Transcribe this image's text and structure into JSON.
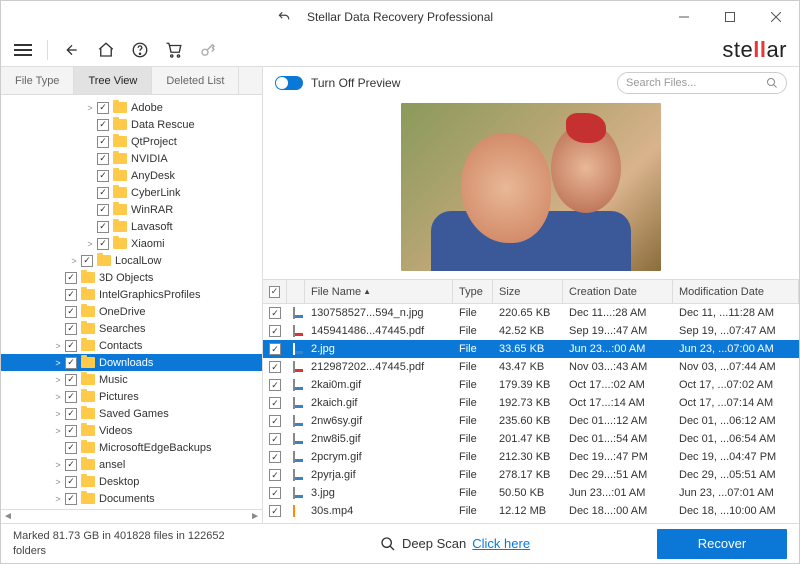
{
  "title": "Stellar Data Recovery Professional",
  "logo": "stellar",
  "tabs": {
    "fileType": "File Type",
    "treeView": "Tree View",
    "deletedList": "Deleted List"
  },
  "previewToggleLabel": "Turn Off Preview",
  "searchPlaceholder": "Search Files...",
  "tree": [
    {
      "indent": 3,
      "arrow": ">",
      "label": "Adobe"
    },
    {
      "indent": 3,
      "arrow": "",
      "label": "Data Rescue"
    },
    {
      "indent": 3,
      "arrow": "",
      "label": "QtProject"
    },
    {
      "indent": 3,
      "arrow": "",
      "label": "NVIDIA"
    },
    {
      "indent": 3,
      "arrow": "",
      "label": "AnyDesk"
    },
    {
      "indent": 3,
      "arrow": "",
      "label": "CyberLink"
    },
    {
      "indent": 3,
      "arrow": "",
      "label": "WinRAR"
    },
    {
      "indent": 3,
      "arrow": "",
      "label": "Lavasoft"
    },
    {
      "indent": 3,
      "arrow": ">",
      "label": "Xiaomi"
    },
    {
      "indent": 2,
      "arrow": ">",
      "label": "LocalLow"
    },
    {
      "indent": 1,
      "arrow": "",
      "label": "3D Objects"
    },
    {
      "indent": 1,
      "arrow": "",
      "label": "IntelGraphicsProfiles"
    },
    {
      "indent": 1,
      "arrow": "",
      "label": "OneDrive"
    },
    {
      "indent": 1,
      "arrow": "",
      "label": "Searches"
    },
    {
      "indent": 1,
      "arrow": ">",
      "label": "Contacts"
    },
    {
      "indent": 1,
      "arrow": ">",
      "label": "Downloads",
      "selected": true
    },
    {
      "indent": 1,
      "arrow": ">",
      "label": "Music"
    },
    {
      "indent": 1,
      "arrow": ">",
      "label": "Pictures"
    },
    {
      "indent": 1,
      "arrow": ">",
      "label": "Saved Games"
    },
    {
      "indent": 1,
      "arrow": ">",
      "label": "Videos"
    },
    {
      "indent": 1,
      "arrow": "",
      "label": "MicrosoftEdgeBackups"
    },
    {
      "indent": 1,
      "arrow": ">",
      "label": "ansel"
    },
    {
      "indent": 1,
      "arrow": ">",
      "label": "Desktop"
    },
    {
      "indent": 1,
      "arrow": ">",
      "label": "Documents"
    }
  ],
  "tableHead": {
    "name": "File Name",
    "type": "Type",
    "size": "Size",
    "cdate": "Creation Date",
    "mdate": "Modification Date"
  },
  "files": [
    {
      "icon": "img",
      "name": "130758527...594_n.jpg",
      "type": "File",
      "size": "220.65 KB",
      "cdate": "Dec 11...:28 AM",
      "mdate": "Dec 11, ...11:28 AM"
    },
    {
      "icon": "pdf",
      "name": "145941486...47445.pdf",
      "type": "File",
      "size": "42.52 KB",
      "cdate": "Sep 19...:47 AM",
      "mdate": "Sep 19, ...07:47 AM"
    },
    {
      "icon": "img",
      "name": "2.jpg",
      "type": "File",
      "size": "33.65 KB",
      "cdate": "Jun 23...:00 AM",
      "mdate": "Jun 23, ...07:00 AM",
      "selected": true
    },
    {
      "icon": "pdf",
      "name": "212987202...47445.pdf",
      "type": "File",
      "size": "43.47 KB",
      "cdate": "Nov 03...:43 AM",
      "mdate": "Nov 03, ...07:44 AM"
    },
    {
      "icon": "img",
      "name": "2kai0m.gif",
      "type": "File",
      "size": "179.39 KB",
      "cdate": "Oct 17...:02 AM",
      "mdate": "Oct 17, ...07:02 AM"
    },
    {
      "icon": "img",
      "name": "2kaich.gif",
      "type": "File",
      "size": "192.73 KB",
      "cdate": "Oct 17...:14 AM",
      "mdate": "Oct 17, ...07:14 AM"
    },
    {
      "icon": "img",
      "name": "2nw6sy.gif",
      "type": "File",
      "size": "235.60 KB",
      "cdate": "Dec 01...:12 AM",
      "mdate": "Dec 01, ...06:12 AM"
    },
    {
      "icon": "img",
      "name": "2nw8i5.gif",
      "type": "File",
      "size": "201.47 KB",
      "cdate": "Dec 01...:54 AM",
      "mdate": "Dec 01, ...06:54 AM"
    },
    {
      "icon": "img",
      "name": "2pcrym.gif",
      "type": "File",
      "size": "212.30 KB",
      "cdate": "Dec 19...:47 PM",
      "mdate": "Dec 19, ...04:47 PM"
    },
    {
      "icon": "img",
      "name": "2pyrja.gif",
      "type": "File",
      "size": "278.17 KB",
      "cdate": "Dec 29...:51 AM",
      "mdate": "Dec 29, ...05:51 AM"
    },
    {
      "icon": "img",
      "name": "3.jpg",
      "type": "File",
      "size": "50.50 KB",
      "cdate": "Jun 23...:01 AM",
      "mdate": "Jun 23, ...07:01 AM"
    },
    {
      "icon": "vid",
      "name": "30s.mp4",
      "type": "File",
      "size": "12.12 MB",
      "cdate": "Dec 18...:00 AM",
      "mdate": "Dec 18, ...10:00 AM"
    }
  ],
  "statusText": "Marked 81.73 GB in 401828 files in 122652 folders",
  "deepScan": {
    "label": "Deep Scan",
    "link": "Click here"
  },
  "recoverLabel": "Recover"
}
